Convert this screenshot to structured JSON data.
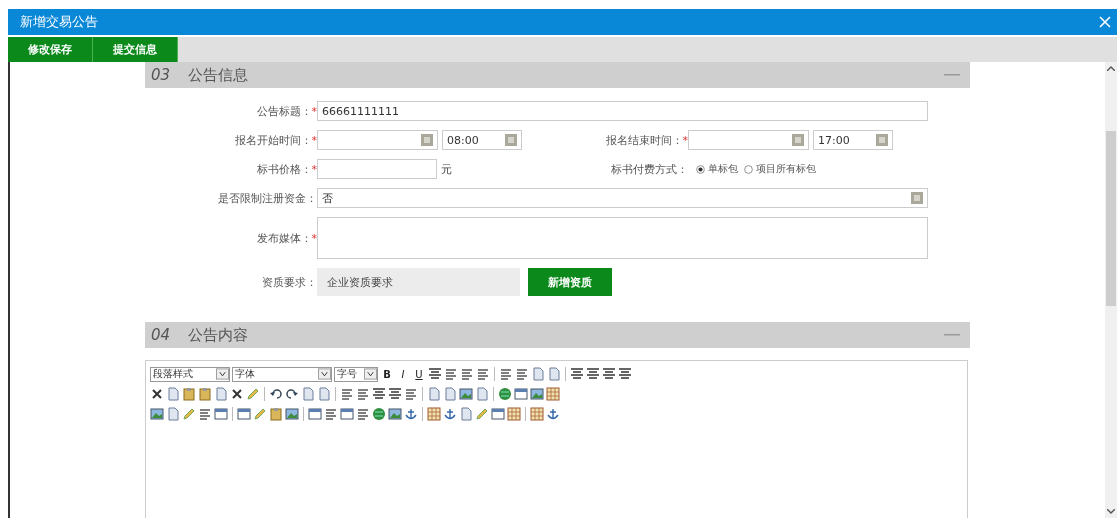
{
  "window": {
    "title": "新增交易公告"
  },
  "toolbar": {
    "buttons": [
      "修改保存",
      "提交信息"
    ]
  },
  "info_section": {
    "number": "03",
    "title": "公告信息",
    "rows": [
      {
        "fields": [
          {
            "kind": "text",
            "label": "公告标题：",
            "required_mark": "*",
            "value": "66661111111"
          }
        ]
      },
      {
        "fields": [
          {
            "kind": "datetime",
            "label": "报名开始时间：",
            "required_mark": "*",
            "time": "08:00"
          },
          {
            "kind": "datetime",
            "label": "报名结束时间：",
            "required_mark": "*",
            "time": "17:00"
          }
        ]
      },
      {
        "fields": [
          {
            "kind": "money",
            "label": "标书价格：",
            "required_mark": "*",
            "unit": "元"
          },
          {
            "kind": "radio",
            "label": "标书付费方式：",
            "options": [
              {
                "label": "单标包",
                "selected": true
              },
              {
                "label": "项目所有标包",
                "selected": false
              }
            ]
          }
        ]
      },
      {
        "fields": [
          {
            "kind": "select",
            "label": "是否限制注册资金：",
            "value": "否"
          }
        ]
      },
      {
        "fields": [
          {
            "kind": "textarea",
            "label": "发布媒体：",
            "required_mark": "*"
          }
        ]
      },
      {
        "fields": [
          {
            "kind": "qualification",
            "label": "资质要求：",
            "value": "企业资质要求",
            "button": "新增资质"
          }
        ]
      }
    ]
  },
  "content_section": {
    "number": "04",
    "title": "公告内容",
    "editor": {
      "selects": [
        "段落样式",
        "字体",
        "字号"
      ],
      "format_buttons": [
        "B",
        "I",
        "U"
      ]
    }
  }
}
